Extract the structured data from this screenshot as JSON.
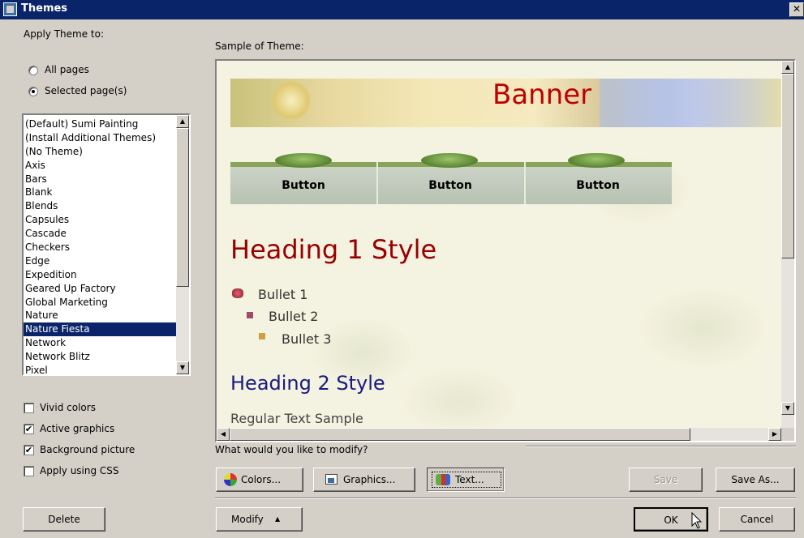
{
  "window": {
    "title": "Themes",
    "close_label": "✕"
  },
  "apply_theme": {
    "label": "Apply Theme to:",
    "options": [
      {
        "label": "All pages",
        "selected": false
      },
      {
        "label": "Selected page(s)",
        "selected": true
      }
    ]
  },
  "theme_list": {
    "items": [
      "(Default) Sumi Painting",
      "(Install Additional Themes)",
      "(No Theme)",
      "Axis",
      "Bars",
      "Blank",
      "Blends",
      "Capsules",
      "Cascade",
      "Checkers",
      "Edge",
      "Expedition",
      "Geared Up Factory",
      "Global Marketing",
      "Nature",
      "Nature Fiesta",
      "Network",
      "Network Blitz",
      "Pixel"
    ],
    "selected": "Nature Fiesta"
  },
  "options": [
    {
      "label": "Vivid colors",
      "checked": false
    },
    {
      "label": "Active graphics",
      "checked": true
    },
    {
      "label": "Background picture",
      "checked": true
    },
    {
      "label": "Apply using CSS",
      "checked": false
    }
  ],
  "sample": {
    "label": "Sample of Theme:",
    "banner": "Banner",
    "buttons": [
      "Button",
      "Button",
      "Button"
    ],
    "heading1": "Heading 1 Style",
    "bullets": [
      "Bullet 1",
      "Bullet 2",
      "Bullet 3"
    ],
    "heading2": "Heading 2 Style",
    "body_text": "Regular Text Sample"
  },
  "modify": {
    "question": "What would you like to modify?",
    "colors_label": "Colors...",
    "graphics_label": "Graphics...",
    "text_label": "Text...",
    "save_label": "Save",
    "save_as_label": "Save As..."
  },
  "footer": {
    "delete_label": "Delete",
    "modify_label": "Modify",
    "modify_arrow": "▲",
    "ok_label": "OK",
    "cancel_label": "Cancel"
  },
  "scroll_glyphs": {
    "up": "▲",
    "down": "▼",
    "left": "◀",
    "right": "▶"
  },
  "check_mark": "✔",
  "colors": {
    "titlebar": "#0a246a",
    "face": "#d4d0c8",
    "selection": "#0a246a",
    "banner_text": "#c00000",
    "heading1": "#990000",
    "heading2": "#1a1a80"
  }
}
